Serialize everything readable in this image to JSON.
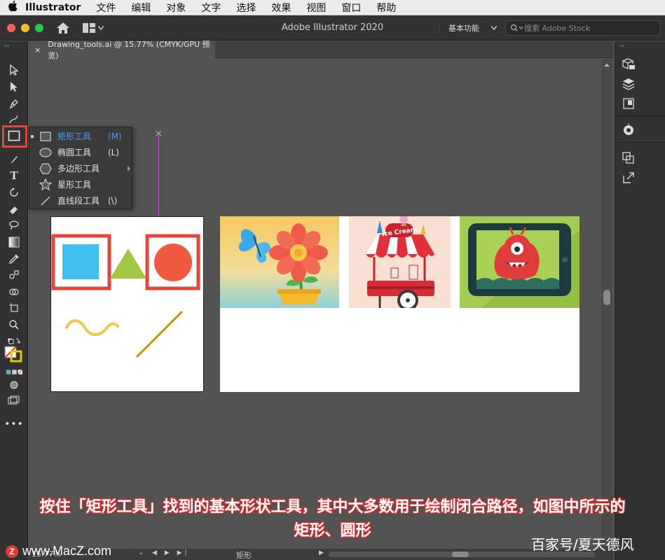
{
  "menubar": {
    "apple": "",
    "app_name": "Illustrator",
    "items": [
      "文件",
      "编辑",
      "对象",
      "文字",
      "选择",
      "效果",
      "视图",
      "窗口",
      "帮助"
    ]
  },
  "titlebar": {
    "title": "Adobe Illustrator 2020",
    "workspace": "基本功能",
    "search_placeholder": "搜索 Adobe Stock"
  },
  "document_tab": {
    "close": "×",
    "label": "Drawing_tools.ai @ 15.77% (CMYK/GPU 预览)"
  },
  "flyout": {
    "items": [
      {
        "label": "矩形工具",
        "shortcut": "(M)",
        "icon": "rectangle-icon",
        "selected": true
      },
      {
        "label": "椭圆工具",
        "shortcut": "(L)",
        "icon": "ellipse-icon",
        "selected": false
      },
      {
        "label": "多边形工具",
        "shortcut": "",
        "icon": "polygon-icon",
        "selected": false
      },
      {
        "label": "星形工具",
        "shortcut": "",
        "icon": "star-icon",
        "selected": false
      },
      {
        "label": "直线段工具",
        "shortcut": "(\\)",
        "icon": "line-segment-icon",
        "selected": false
      }
    ]
  },
  "artwork": {
    "ice_cream_sign": "Ice Cream"
  },
  "caption": {
    "line1": "按住「矩形工具」找到的基本形状工具，其中大多数用于绘制闭合路径，如图中所示的",
    "line2": "矩形、圆形"
  },
  "statusbar": {
    "zoom": "15.77%",
    "current_tool": "矩形"
  },
  "watermarks": {
    "left_logo": "Z",
    "left_text": "www.MacZ.com",
    "right_text": "百家号/夏天德风"
  },
  "colors": {
    "highlight_red": "#e2473a",
    "selected_blue": "#4b9df5",
    "guide_magenta": "#c34fd0"
  }
}
